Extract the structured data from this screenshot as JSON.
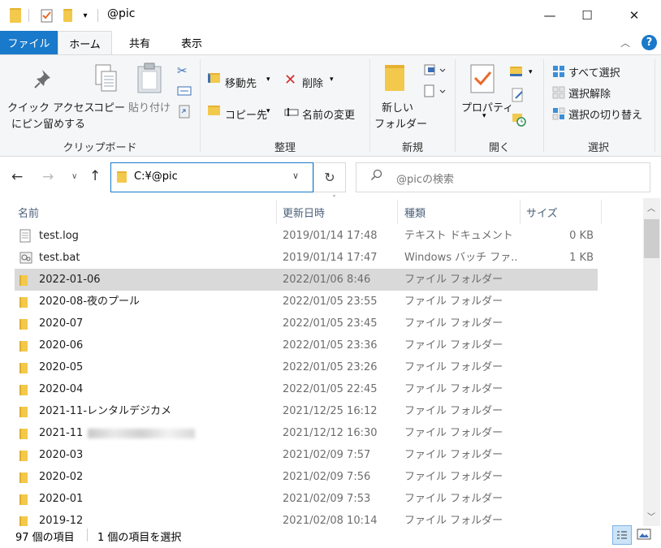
{
  "window": {
    "title": "@pic",
    "controls": {
      "minimize": "—",
      "maximize": "☐",
      "close": "✕"
    }
  },
  "tabs": [
    {
      "label": "ファイル"
    },
    {
      "label": "ホーム"
    },
    {
      "label": "共有"
    },
    {
      "label": "表示"
    }
  ],
  "ribbon": {
    "clipboard": {
      "pin_label_1": "クイック アクセス",
      "pin_label_2": "にピン留めする",
      "copy_label": "コピー",
      "paste_label": "貼り付け",
      "group_label": "クリップボード"
    },
    "organize": {
      "move_to": "移動先",
      "copy_to": "コピー先",
      "delete": "削除",
      "rename": "名前の変更",
      "group_label": "整理"
    },
    "new": {
      "new_folder_1": "新しい",
      "new_folder_2": "フォルダー",
      "group_label": "新規"
    },
    "open": {
      "properties": "プロパティ",
      "group_label": "開く"
    },
    "select": {
      "select_all": "すべて選択",
      "select_none": "選択解除",
      "invert": "選択の切り替え",
      "group_label": "選択"
    }
  },
  "address": {
    "path": "C:¥@pic",
    "search_placeholder": "@picの検索"
  },
  "columns": {
    "name": "名前",
    "date": "更新日時",
    "type": "種類",
    "size": "サイズ"
  },
  "files": [
    {
      "name": "test.log",
      "date": "2019/01/14 17:48",
      "type": "テキスト ドキュメント",
      "size": "0 KB",
      "icon": "text-file-icon"
    },
    {
      "name": "test.bat",
      "date": "2019/01/14 17:47",
      "type": "Windows バッチ ファ...",
      "size": "1 KB",
      "icon": "batch-file-icon"
    },
    {
      "name": "2022-01-06",
      "date": "2022/01/06 8:46",
      "type": "ファイル フォルダー",
      "size": "",
      "icon": "folder-icon",
      "selected": true
    },
    {
      "name": "2020-08-夜のプール",
      "date": "2022/01/05 23:55",
      "type": "ファイル フォルダー",
      "size": "",
      "icon": "folder-icon"
    },
    {
      "name": "2020-07",
      "date": "2022/01/05 23:45",
      "type": "ファイル フォルダー",
      "size": "",
      "icon": "folder-icon"
    },
    {
      "name": "2020-06",
      "date": "2022/01/05 23:36",
      "type": "ファイル フォルダー",
      "size": "",
      "icon": "folder-icon"
    },
    {
      "name": "2020-05",
      "date": "2022/01/05 23:26",
      "type": "ファイル フォルダー",
      "size": "",
      "icon": "folder-icon"
    },
    {
      "name": "2020-04",
      "date": "2022/01/05 22:45",
      "type": "ファイル フォルダー",
      "size": "",
      "icon": "folder-icon"
    },
    {
      "name": "2021-11-レンタルデジカメ",
      "date": "2021/12/25 16:12",
      "type": "ファイル フォルダー",
      "size": "",
      "icon": "folder-icon"
    },
    {
      "name": "2021-11",
      "date": "2021/12/12 16:30",
      "type": "ファイル フォルダー",
      "size": "",
      "icon": "folder-icon",
      "blurred": true
    },
    {
      "name": "2020-03",
      "date": "2021/02/09 7:57",
      "type": "ファイル フォルダー",
      "size": "",
      "icon": "folder-icon"
    },
    {
      "name": "2020-02",
      "date": "2021/02/09 7:56",
      "type": "ファイル フォルダー",
      "size": "",
      "icon": "folder-icon"
    },
    {
      "name": "2020-01",
      "date": "2021/02/09 7:53",
      "type": "ファイル フォルダー",
      "size": "",
      "icon": "folder-icon"
    },
    {
      "name": "2019-12",
      "date": "2021/02/08 10:14",
      "type": "ファイル フォルダー",
      "size": "",
      "icon": "folder-icon"
    }
  ],
  "status": {
    "count": "97 個の項目",
    "selected": "1 個の項目を選択"
  },
  "colors": {
    "accent": "#1979ca",
    "folder": "#f2c94c",
    "selection": "#d9d9d9",
    "delete_red": "#d32f2f",
    "properties_orange": "#e96a2b"
  }
}
